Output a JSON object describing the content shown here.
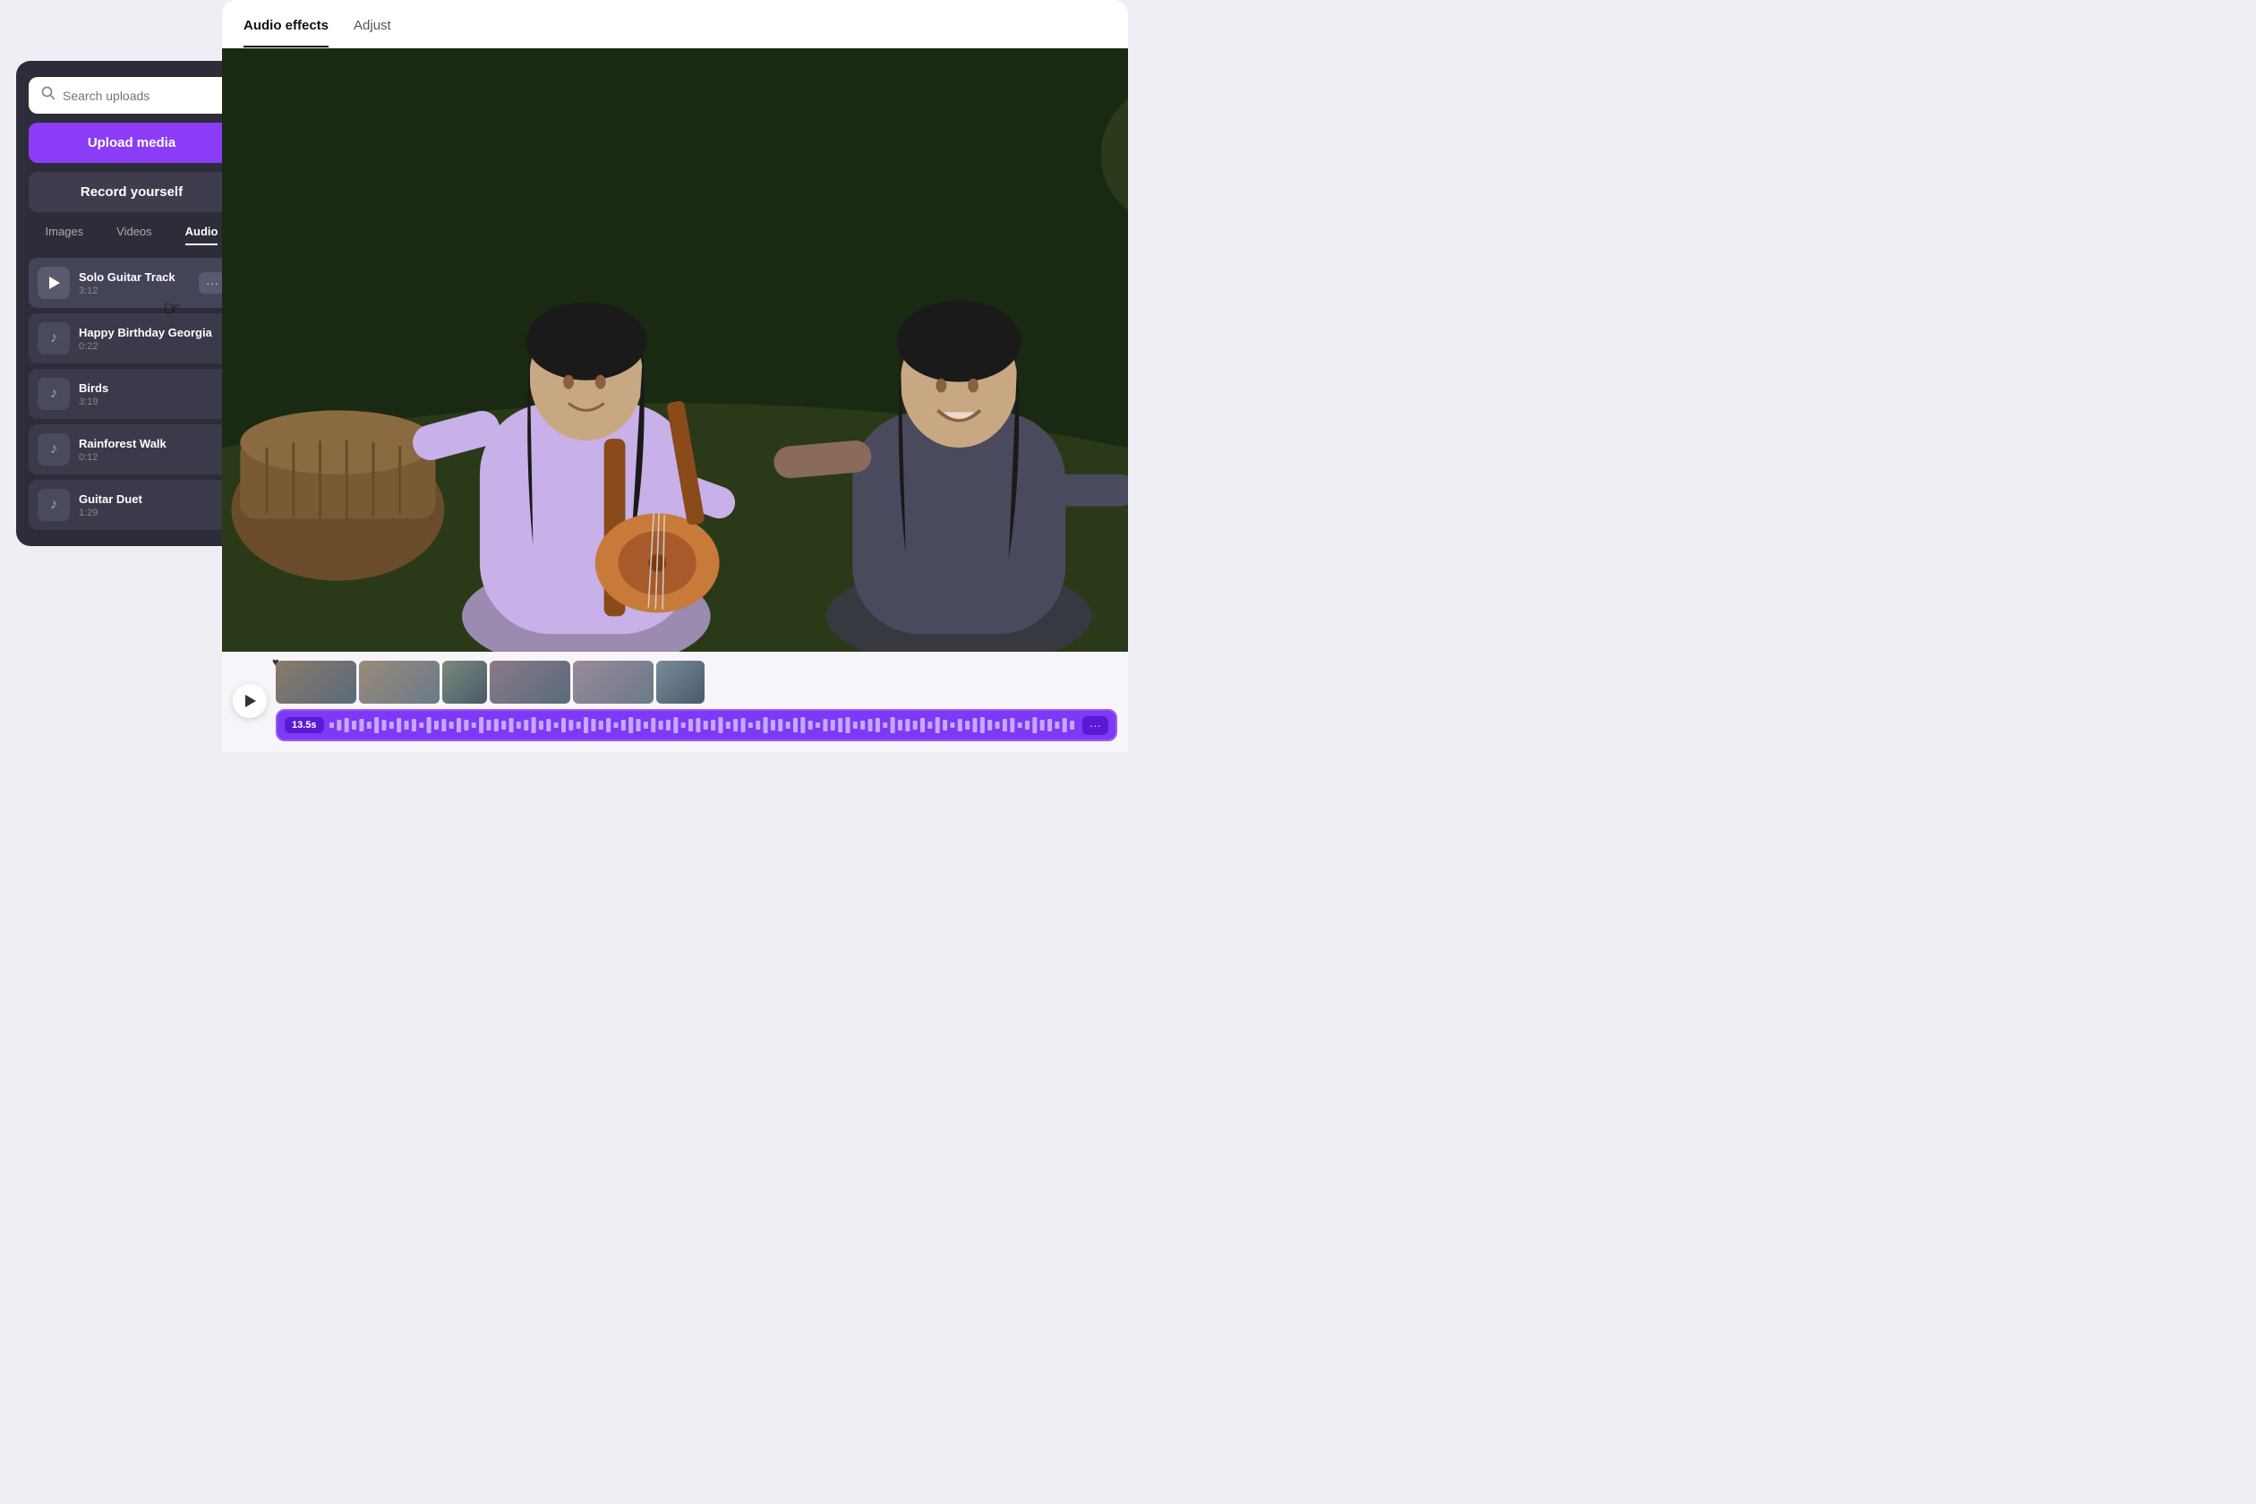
{
  "leftPanel": {
    "search": {
      "placeholder": "Search uploads"
    },
    "uploadBtn": "Upload media",
    "recordBtn": "Record yourself",
    "tabs": [
      {
        "label": "Images",
        "active": false
      },
      {
        "label": "Videos",
        "active": false
      },
      {
        "label": "Audio",
        "active": true
      }
    ],
    "audioItems": [
      {
        "id": 1,
        "name": "Solo Guitar Track",
        "duration": "3:12",
        "active": true,
        "hasPlay": true,
        "hasMore": true
      },
      {
        "id": 2,
        "name": "Happy Birthday Georgia",
        "duration": "0:22",
        "active": false,
        "hasPlay": false,
        "hasMore": false
      },
      {
        "id": 3,
        "name": "Birds",
        "duration": "3:19",
        "active": false,
        "hasPlay": false,
        "hasMore": false
      },
      {
        "id": 4,
        "name": "Rainforest Walk",
        "duration": "0:12",
        "active": false,
        "hasPlay": false,
        "hasMore": false
      },
      {
        "id": 5,
        "name": "Guitar Duet",
        "duration": "1:29",
        "active": false,
        "hasPlay": false,
        "hasMore": false
      }
    ]
  },
  "rightPanel": {
    "tabs": [
      {
        "label": "Audio effects",
        "active": true
      },
      {
        "label": "Adjust",
        "active": false
      }
    ],
    "timeline": {
      "timeBadge": "13.5s",
      "moreLabel": "···"
    }
  }
}
